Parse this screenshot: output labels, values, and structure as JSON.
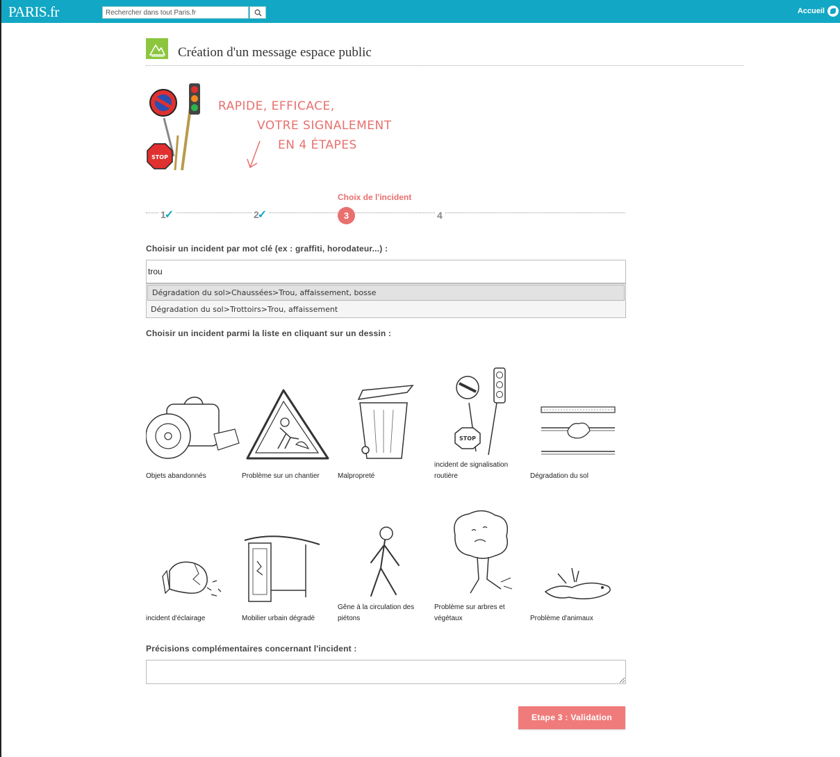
{
  "topbar": {
    "logo": "PARIS.fr",
    "search_placeholder": "Rechercher dans tout Paris.fr",
    "search_button_icon": "magnifier-icon",
    "home_label": "Accueil",
    "home_icon": "paris-logo-icon",
    "bar_color": "#12a7c4"
  },
  "header": {
    "title": "Création d'un message espace public",
    "icon": "mountain-icon",
    "icon_color": "#8cc63f"
  },
  "hero": {
    "lines": [
      "RAPIDE, EFFICACE,",
      "VOTRE SIGNALEMENT",
      "EN 4 ÉTAPES"
    ],
    "accent_color": "#e8706f"
  },
  "steps": {
    "items": [
      {
        "number": "1",
        "state": "done"
      },
      {
        "number": "2",
        "state": "done"
      },
      {
        "number": "3",
        "state": "current"
      },
      {
        "number": "4",
        "state": "pending"
      }
    ],
    "current_label": "Choix de l'incident"
  },
  "keyword": {
    "label": "Choisir un incident par mot clé (ex : graffiti, horodateur...) :",
    "value": "trou",
    "suggestions": [
      "Dégradation du sol>Chaussées>Trou, affaissement, bosse",
      "Dégradation du sol>Trottoirs>Trou, affaissement"
    ]
  },
  "picker": {
    "label": "Choisir un incident parmi la liste en cliquant sur un dessin :",
    "tiles": [
      {
        "caption": "Objets abandonnés",
        "icon": "abandoned-objects-icon"
      },
      {
        "caption": "Problème sur un chantier",
        "icon": "roadwork-sign-icon"
      },
      {
        "caption": "Malpropreté",
        "icon": "trash-bin-icon"
      },
      {
        "caption": "incident de signalisation routière",
        "icon": "traffic-signs-icon"
      },
      {
        "caption": "Dégradation du sol",
        "icon": "damaged-road-icon"
      },
      {
        "caption": "incident d'éclairage",
        "icon": "broken-bulb-icon"
      },
      {
        "caption": "Mobilier urbain dégradé",
        "icon": "bus-shelter-icon"
      },
      {
        "caption": "Gêne à la circulation des piétons",
        "icon": "pedestrian-icon"
      },
      {
        "caption": "Problème sur arbres et végétaux",
        "icon": "tree-icon"
      },
      {
        "caption": "Problème d'animaux",
        "icon": "pigeon-icon"
      }
    ]
  },
  "details": {
    "label": "Précisions complémentaires concernant l'incident :",
    "value": ""
  },
  "submit": {
    "label": "Etape 3 : Validation",
    "color": "#f07b7b"
  }
}
